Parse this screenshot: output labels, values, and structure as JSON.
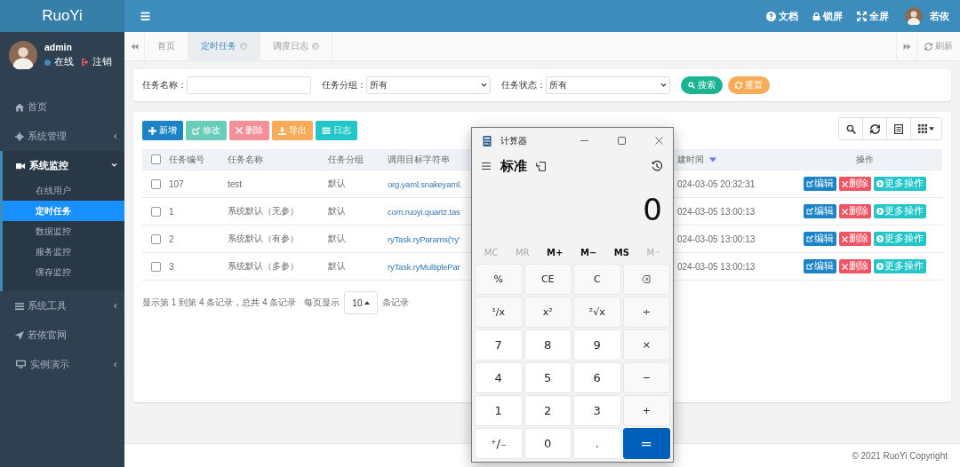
{
  "brand": "RuoYi",
  "user": {
    "name": "admin",
    "status": "在线",
    "logout": "注销"
  },
  "menu": [
    {
      "label": "首页",
      "kind": "link"
    },
    {
      "label": "系统管理",
      "kind": "group",
      "expanded": false
    },
    {
      "label": "系统监控",
      "kind": "group",
      "expanded": true,
      "children": [
        {
          "label": "在线用户",
          "selected": false
        },
        {
          "label": "定时任务",
          "selected": true
        },
        {
          "label": "数据监控",
          "selected": false
        },
        {
          "label": "服务监控",
          "selected": false
        },
        {
          "label": "缓存监控",
          "selected": false
        }
      ]
    },
    {
      "label": "系统工具",
      "kind": "group",
      "expanded": false
    },
    {
      "label": "若依官网",
      "kind": "link"
    },
    {
      "label": "实例演示",
      "kind": "group",
      "expanded": false
    }
  ],
  "topbar": {
    "links": [
      "文档",
      "锁屏",
      "全屏"
    ],
    "user": "若依"
  },
  "tabs": [
    {
      "label": "首页",
      "closable": false,
      "selected": false
    },
    {
      "label": "定时任务",
      "closable": true,
      "selected": true
    },
    {
      "label": "调度日志",
      "closable": true,
      "selected": false
    }
  ],
  "refresh": "刷新",
  "search": {
    "fields": [
      {
        "label": "任务名称：",
        "kind": "text"
      },
      {
        "label": "任务分组：",
        "kind": "select",
        "value": "所有"
      },
      {
        "label": "任务状态：",
        "kind": "select",
        "value": "所有"
      }
    ],
    "buttons": [
      {
        "label": "搜索",
        "kind": "success"
      },
      {
        "label": "重置",
        "kind": "warning"
      }
    ]
  },
  "toolbar": [
    {
      "label": "新增",
      "kind": "primary",
      "disabled": false
    },
    {
      "label": "修改",
      "kind": "success",
      "disabled": true
    },
    {
      "label": "删除",
      "kind": "danger",
      "disabled": true
    },
    {
      "label": "导出",
      "kind": "warning",
      "disabled": false
    },
    {
      "label": "日志",
      "kind": "info",
      "disabled": false
    }
  ],
  "table": {
    "select_all": false,
    "columns": [
      {
        "label": "任务编号",
        "sorted": false
      },
      {
        "label": "任务名称",
        "sorted": false
      },
      {
        "label": "任务分组",
        "sorted": false
      },
      {
        "label": "调用目标字符串",
        "sorted": false
      },
      {
        "label": "建时间",
        "sorted": true
      },
      {
        "label": "操作",
        "sorted": false
      }
    ],
    "rows": [
      {
        "checked": false,
        "id": "107",
        "name": "test",
        "group": "默认",
        "target": "org.yaml.snakeyaml.",
        "created": "024-03-05 20:32:31",
        "actions": [
          "编辑",
          "删除",
          "更多操作"
        ]
      },
      {
        "checked": false,
        "id": "1",
        "name": "系统默认（无参）",
        "group": "默认",
        "target": "com.ruoyi.quartz.tas",
        "created": "024-03-05 13:00:13",
        "actions": [
          "编辑",
          "删除",
          "更多操作"
        ]
      },
      {
        "checked": false,
        "id": "2",
        "name": "系统默认（有参）",
        "group": "默认",
        "target": "ryTask.ryParams('ry'",
        "created": "024-03-05 13:00:13",
        "actions": [
          "编辑",
          "删除",
          "更多操作"
        ]
      },
      {
        "checked": false,
        "id": "3",
        "name": "系统默认（多参）",
        "group": "默认",
        "target": "ryTask.ryMultiplePar",
        "created": "024-03-05 13:00:13",
        "actions": [
          "编辑",
          "删除",
          "更多操作"
        ]
      }
    ]
  },
  "pagination": {
    "summary": "显示第 1 到第 4 条记录，总共 4 条记录",
    "per_page_label": "每页显示",
    "page_size": "10",
    "suffix": "条记录"
  },
  "calculator": {
    "title": "计算器",
    "mode": "标准",
    "display": "0",
    "memory": [
      {
        "label": "MC",
        "disabled": true
      },
      {
        "label": "MR",
        "disabled": true
      },
      {
        "label": "M+",
        "disabled": false
      },
      {
        "label": "M−",
        "disabled": false
      },
      {
        "label": "MS",
        "disabled": false
      },
      {
        "label": "M",
        "disabled": true
      }
    ],
    "keys": [
      {
        "label": "%",
        "kind": "fn"
      },
      {
        "label": "CE",
        "kind": "fn"
      },
      {
        "label": "C",
        "kind": "fn"
      },
      {
        "kind": "backspace"
      },
      {
        "label": "¹/x",
        "kind": "fn"
      },
      {
        "label": "x²",
        "kind": "fn"
      },
      {
        "label": "²√x",
        "kind": "fn"
      },
      {
        "label": "÷",
        "kind": "fn"
      },
      {
        "label": "7",
        "kind": "num"
      },
      {
        "label": "8",
        "kind": "num"
      },
      {
        "label": "9",
        "kind": "num"
      },
      {
        "label": "×",
        "kind": "fn"
      },
      {
        "label": "4",
        "kind": "num"
      },
      {
        "label": "5",
        "kind": "num"
      },
      {
        "label": "6",
        "kind": "num"
      },
      {
        "label": "−",
        "kind": "fn"
      },
      {
        "label": "1",
        "kind": "num"
      },
      {
        "label": "2",
        "kind": "num"
      },
      {
        "label": "3",
        "kind": "num"
      },
      {
        "label": "+",
        "kind": "fn"
      },
      {
        "label": "⁺/₋",
        "kind": "num"
      },
      {
        "label": "0",
        "kind": "num"
      },
      {
        "label": ".",
        "kind": "num"
      },
      {
        "label": "=",
        "kind": "equals"
      }
    ]
  },
  "footer": "© 2021 RuoYi Copyright"
}
